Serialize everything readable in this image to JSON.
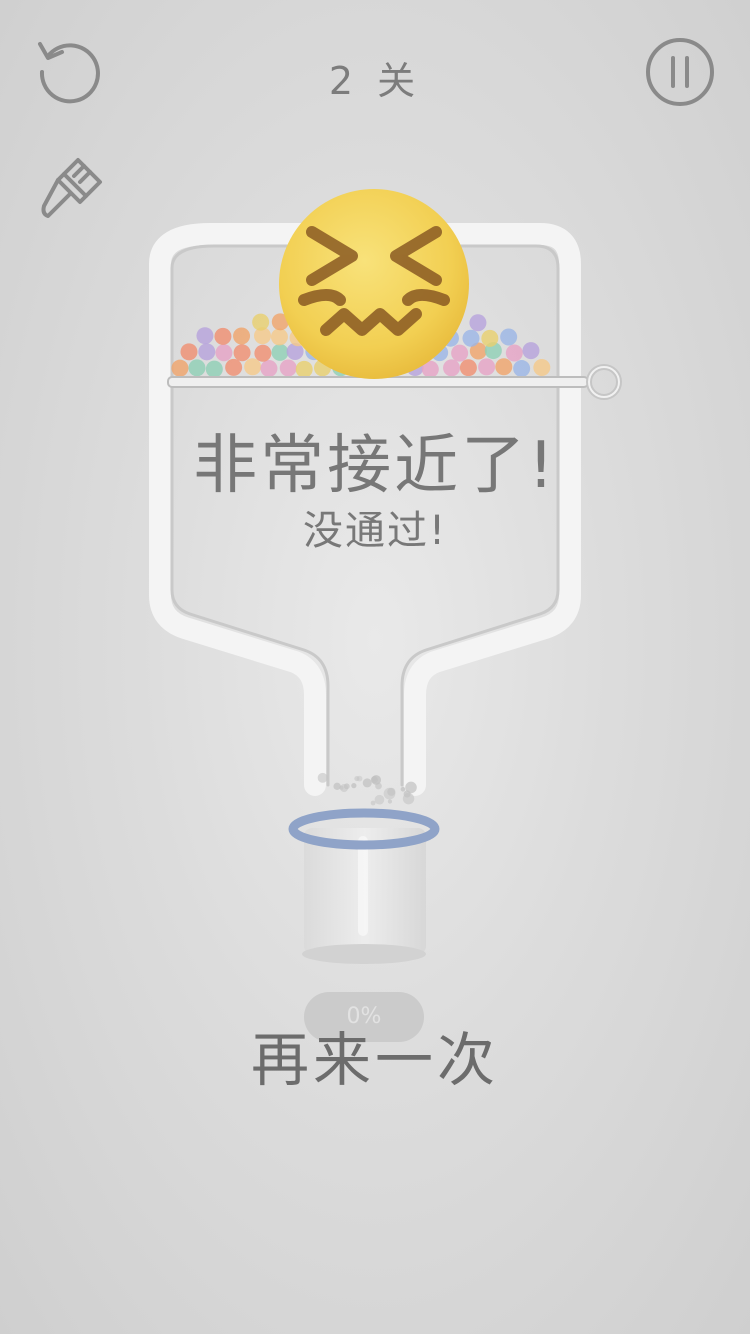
{
  "hud": {
    "level_label": "2 关",
    "restart_icon": "restart-icon",
    "pause_icon": "pause-icon",
    "brush_icon": "paintbrush-icon"
  },
  "result": {
    "title": "非常接近了!",
    "subtitle": "没通过!",
    "face": "confounded-face-emoji"
  },
  "progress": {
    "value": 0,
    "label": "0%"
  },
  "actions": {
    "retry_label": "再来一次"
  },
  "colors": {
    "background": "#dcdcdc",
    "bottle_outline": "#f4f4f4",
    "cup_ring": "#8fa3c8",
    "emoji_yellow": "#f4d35a",
    "ball_colors": [
      "#f0a46a",
      "#e6a2c6",
      "#b7a2dc",
      "#f5c98a",
      "#8fd0b5",
      "#9bb5e6",
      "#f08f70",
      "#e8d06e"
    ]
  }
}
